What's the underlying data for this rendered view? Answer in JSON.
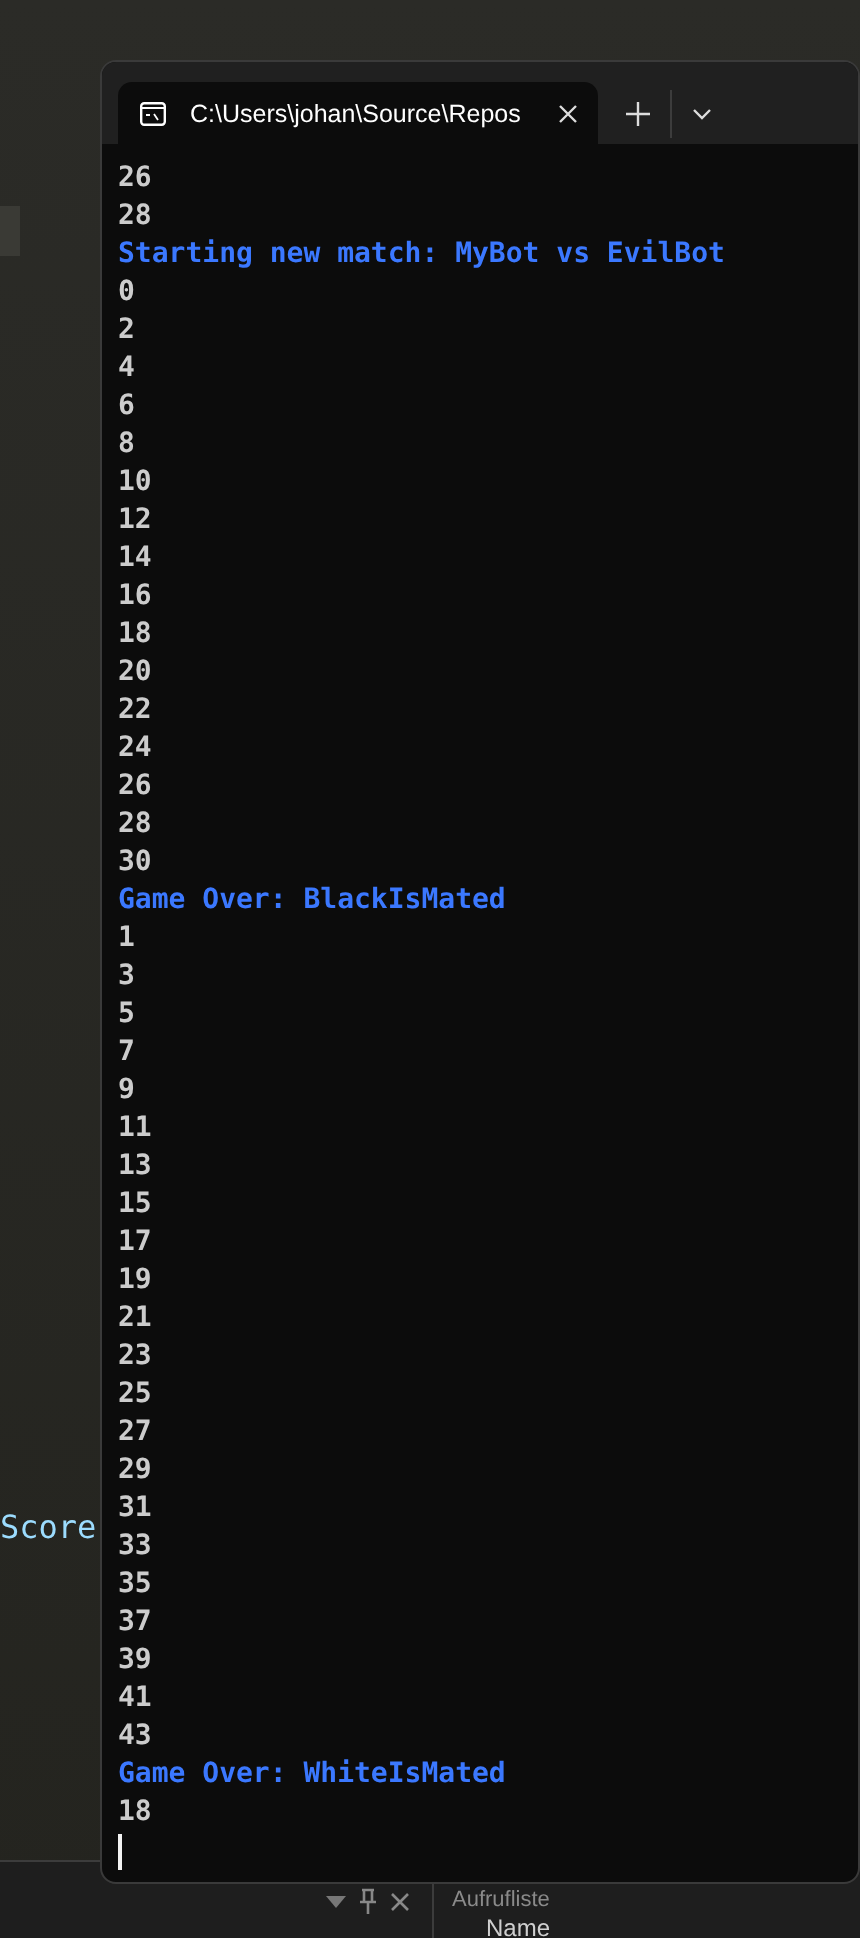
{
  "ide": {
    "code_fragment": "Score",
    "panel_title": "Aufrufliste",
    "panel_column": "Name"
  },
  "terminal": {
    "tab": {
      "title": "C:\\Users\\johan\\Source\\Repos",
      "selected": true
    },
    "lines": [
      {
        "text": "26",
        "kind": "output"
      },
      {
        "text": "28",
        "kind": "output"
      },
      {
        "text": "Starting new match: MyBot vs EvilBot",
        "kind": "status"
      },
      {
        "text": "0",
        "kind": "output"
      },
      {
        "text": "2",
        "kind": "output"
      },
      {
        "text": "4",
        "kind": "output"
      },
      {
        "text": "6",
        "kind": "output"
      },
      {
        "text": "8",
        "kind": "output"
      },
      {
        "text": "10",
        "kind": "output"
      },
      {
        "text": "12",
        "kind": "output"
      },
      {
        "text": "14",
        "kind": "output"
      },
      {
        "text": "16",
        "kind": "output"
      },
      {
        "text": "18",
        "kind": "output"
      },
      {
        "text": "20",
        "kind": "output"
      },
      {
        "text": "22",
        "kind": "output"
      },
      {
        "text": "24",
        "kind": "output"
      },
      {
        "text": "26",
        "kind": "output"
      },
      {
        "text": "28",
        "kind": "output"
      },
      {
        "text": "30",
        "kind": "output"
      },
      {
        "text": "Game Over: BlackIsMated",
        "kind": "status"
      },
      {
        "text": "1",
        "kind": "output"
      },
      {
        "text": "3",
        "kind": "output"
      },
      {
        "text": "5",
        "kind": "output"
      },
      {
        "text": "7",
        "kind": "output"
      },
      {
        "text": "9",
        "kind": "output"
      },
      {
        "text": "11",
        "kind": "output"
      },
      {
        "text": "13",
        "kind": "output"
      },
      {
        "text": "15",
        "kind": "output"
      },
      {
        "text": "17",
        "kind": "output"
      },
      {
        "text": "19",
        "kind": "output"
      },
      {
        "text": "21",
        "kind": "output"
      },
      {
        "text": "23",
        "kind": "output"
      },
      {
        "text": "25",
        "kind": "output"
      },
      {
        "text": "27",
        "kind": "output"
      },
      {
        "text": "29",
        "kind": "output"
      },
      {
        "text": "31",
        "kind": "output"
      },
      {
        "text": "33",
        "kind": "output"
      },
      {
        "text": "35",
        "kind": "output"
      },
      {
        "text": "37",
        "kind": "output"
      },
      {
        "text": "39",
        "kind": "output"
      },
      {
        "text": "41",
        "kind": "output"
      },
      {
        "text": "43",
        "kind": "output"
      },
      {
        "text": "Game Over: WhiteIsMated",
        "kind": "status"
      },
      {
        "text": "18",
        "kind": "output"
      }
    ]
  }
}
